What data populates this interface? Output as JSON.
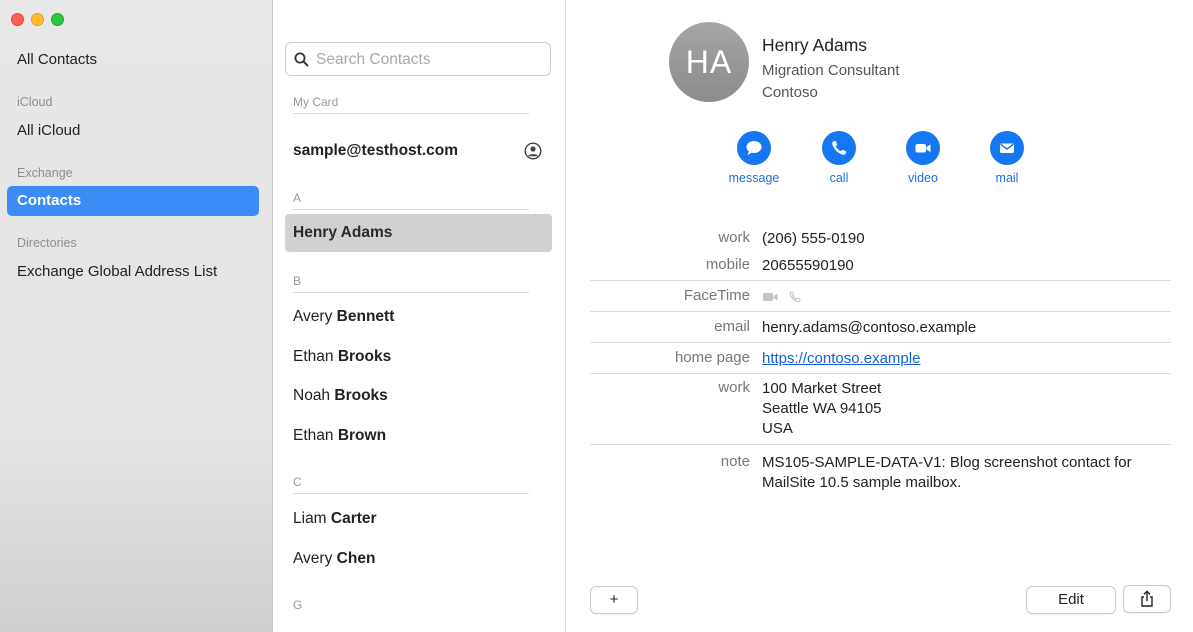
{
  "window": {
    "traffic_lights": [
      "close",
      "minimize",
      "zoom"
    ]
  },
  "sidebar": {
    "items": [
      {
        "type": "item",
        "label": "All Contacts"
      },
      {
        "type": "header",
        "label": "iCloud"
      },
      {
        "type": "item",
        "label": "All iCloud"
      },
      {
        "type": "header",
        "label": "Exchange"
      },
      {
        "type": "item",
        "label": "Contacts",
        "selected": true
      },
      {
        "type": "header",
        "label": "Directories"
      },
      {
        "type": "item",
        "label": "Exchange Global Address List"
      }
    ]
  },
  "contact_list": {
    "search": {
      "placeholder": "Search Contacts",
      "value": ""
    },
    "my_card": {
      "header": "My Card",
      "email": "sample@testhost.com"
    },
    "sections": [
      {
        "letter": "A",
        "contacts": [
          {
            "first": "Henry",
            "last": "Adams",
            "selected": true
          }
        ]
      },
      {
        "letter": "B",
        "contacts": [
          {
            "first": "Avery",
            "last": "Bennett"
          },
          {
            "first": "Ethan",
            "last": "Brooks"
          },
          {
            "first": "Noah",
            "last": "Brooks"
          },
          {
            "first": "Ethan",
            "last": "Brown"
          }
        ]
      },
      {
        "letter": "C",
        "contacts": [
          {
            "first": "Liam",
            "last": "Carter"
          },
          {
            "first": "Avery",
            "last": "Chen"
          }
        ]
      },
      {
        "letter": "G",
        "contacts": []
      }
    ]
  },
  "detail": {
    "initials": "HA",
    "name": "Henry Adams",
    "job_title": "Migration Consultant",
    "company": "Contoso",
    "actions": [
      {
        "label": "message",
        "icon": "message-bubble-icon"
      },
      {
        "label": "call",
        "icon": "phone-icon"
      },
      {
        "label": "video",
        "icon": "video-camera-icon"
      },
      {
        "label": "mail",
        "icon": "envelope-icon"
      }
    ],
    "fields": {
      "work_phone": {
        "label": "work",
        "value": "(206) 555-0190"
      },
      "mobile": {
        "label": "mobile",
        "value": "20655590190"
      },
      "facetime": {
        "label": "FaceTime"
      },
      "email": {
        "label": "email",
        "value": "henry.adams@contoso.example"
      },
      "home_page": {
        "label": "home page",
        "value": "https://contoso.example"
      },
      "work_address": {
        "label": "work",
        "line1": "100 Market Street",
        "line2": "Seattle WA 94105",
        "line3": "USA"
      },
      "note": {
        "label": "note",
        "value": "MS105-SAMPLE-DATA-V1: Blog screenshot contact for MailSite 10.5 sample mailbox."
      }
    },
    "footer": {
      "add_label": "+",
      "edit_label": "Edit",
      "share_icon": "share-icon"
    }
  },
  "colors": {
    "accent": "#3b8cf6",
    "action_blue": "#1677f2",
    "selected_row": "#d1d1d1",
    "sidebar_bg": "#e6e6e6"
  }
}
